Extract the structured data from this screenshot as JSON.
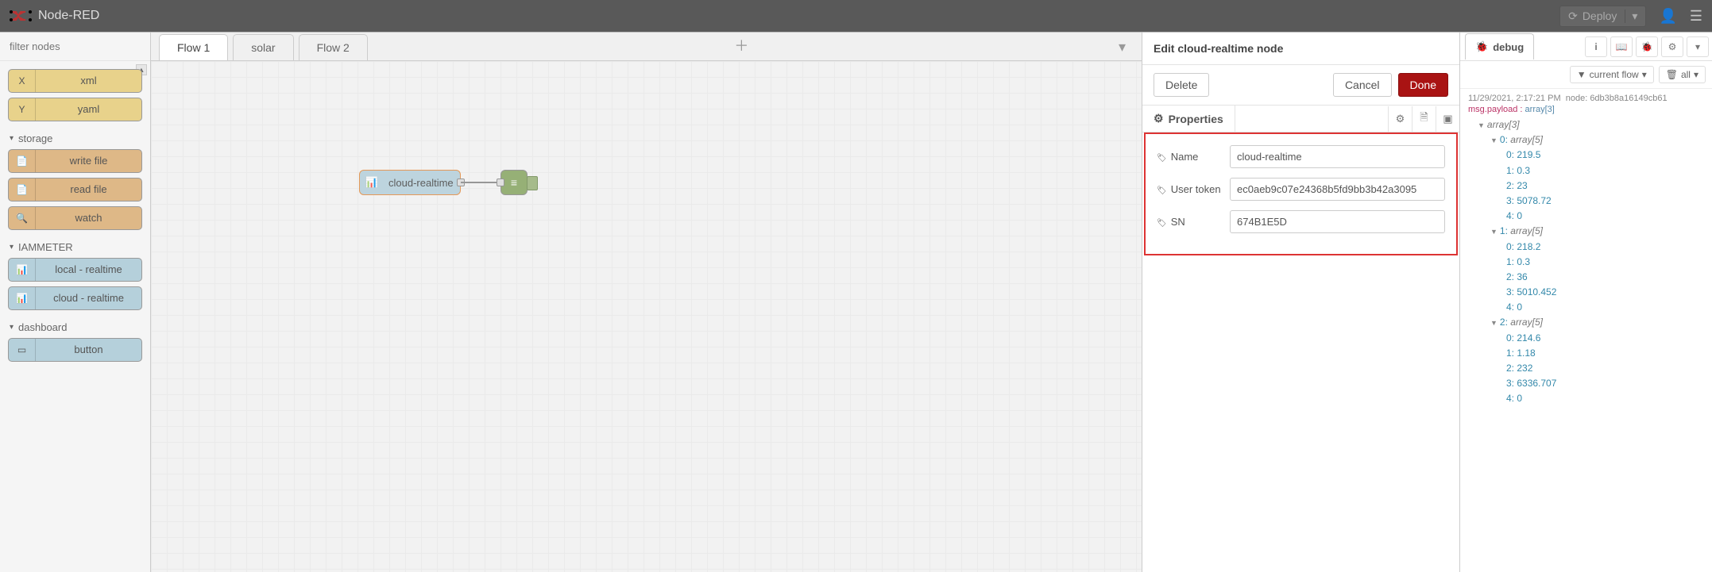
{
  "header": {
    "title": "Node-RED",
    "deploy_label": "Deploy"
  },
  "palette": {
    "filter_placeholder": "filter nodes",
    "cats": {
      "storage": "storage",
      "iammeter": "IAMMETER",
      "dashboard": "dashboard"
    },
    "nodes": {
      "xml": "xml",
      "yaml": "yaml",
      "write_file": "write file",
      "read_file": "read file",
      "watch": "watch",
      "local_rt": "local - realtime",
      "cloud_rt": "cloud - realtime",
      "button": "button"
    }
  },
  "tabs": {
    "t0": "Flow 1",
    "t1": "solar",
    "t2": "Flow 2"
  },
  "canvas": {
    "node_label": "cloud-realtime"
  },
  "tray": {
    "title": "Edit cloud-realtime node",
    "delete": "Delete",
    "cancel": "Cancel",
    "done": "Done",
    "properties": "Properties",
    "labels": {
      "name": "Name",
      "user_token": "User token",
      "sn": "SN"
    },
    "values": {
      "name": "cloud-realtime",
      "user_token": "ec0aeb9c07e24368b5fd9bb3b42a3095",
      "sn": "674B1E5D"
    }
  },
  "sidebar": {
    "tab_label": "debug",
    "filter_label": "current flow",
    "clear_label": "all",
    "msg": {
      "time": "11/29/2021, 2:17:21 PM",
      "node": "node: 6db3b8a16149cb61",
      "topic": "msg.payload",
      "type": "array[3]",
      "outer": "array[3]",
      "inner_type": "array[5]",
      "data": [
        [
          219.5,
          0.3,
          23,
          5078.72,
          0
        ],
        [
          218.2,
          0.3,
          36,
          5010.452,
          0
        ],
        [
          214.6,
          1.18,
          232,
          6336.707,
          0
        ]
      ]
    }
  }
}
